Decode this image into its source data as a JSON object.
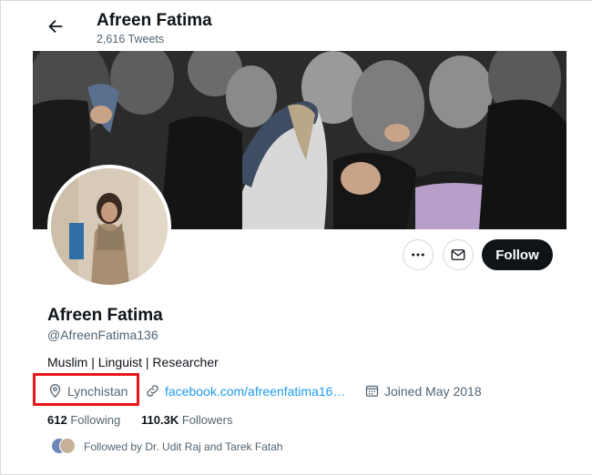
{
  "header": {
    "name": "Afreen Fatima",
    "tweet_count": "2,616 Tweets"
  },
  "profile": {
    "display_name": "Afreen Fatima",
    "handle": "@AfreenFatima136",
    "bio": "Muslim | Linguist | Researcher",
    "location": "Lynchistan",
    "website": "facebook.com/afreenfatima16…",
    "joined": "Joined May 2018"
  },
  "stats": {
    "following_count": "612",
    "following_label": "Following",
    "followers_count": "110.3K",
    "followers_label": "Followers"
  },
  "followed_by": "Followed by Dr. Udit Raj and Tarek Fatah",
  "actions": {
    "follow_label": "Follow"
  },
  "colors": {
    "accent": "#1d9bf0",
    "follow_bg": "#0f1419",
    "highlight": "#e8151b"
  }
}
